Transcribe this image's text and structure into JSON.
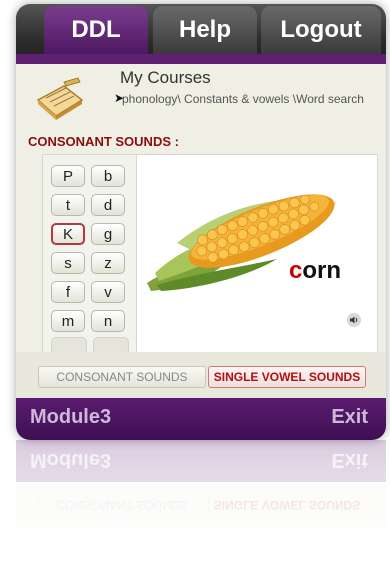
{
  "nav": {
    "ddl": "DDL",
    "help": "Help",
    "logout": "Logout"
  },
  "header": {
    "title": "My Courses",
    "breadcrumb": "phonology\\ Constants & vowels \\Word search"
  },
  "section": {
    "title": "CONSONANT SOUNDS :"
  },
  "keys": [
    "P",
    "b",
    "t",
    "d",
    "K",
    "g",
    "s",
    "z",
    "f",
    "v",
    "m",
    "n"
  ],
  "selected_key": "K",
  "word": {
    "first_letter": "c",
    "rest": "orn"
  },
  "buttons": {
    "consonant": "CONSONANT SOUNDS",
    "vowel": "SINGLE VOWEL SOUNDS"
  },
  "footer": {
    "module": "Module3",
    "exit": "Exit"
  },
  "colors": {
    "accent_purple": "#5e2070",
    "heading_red": "#8b0e0e",
    "word_red": "#c40000"
  },
  "icons": {
    "course_icon": "notebook-pencil-icon",
    "breadcrumb_arrow": "chevron-right-icon",
    "audio": "speaker-icon"
  }
}
